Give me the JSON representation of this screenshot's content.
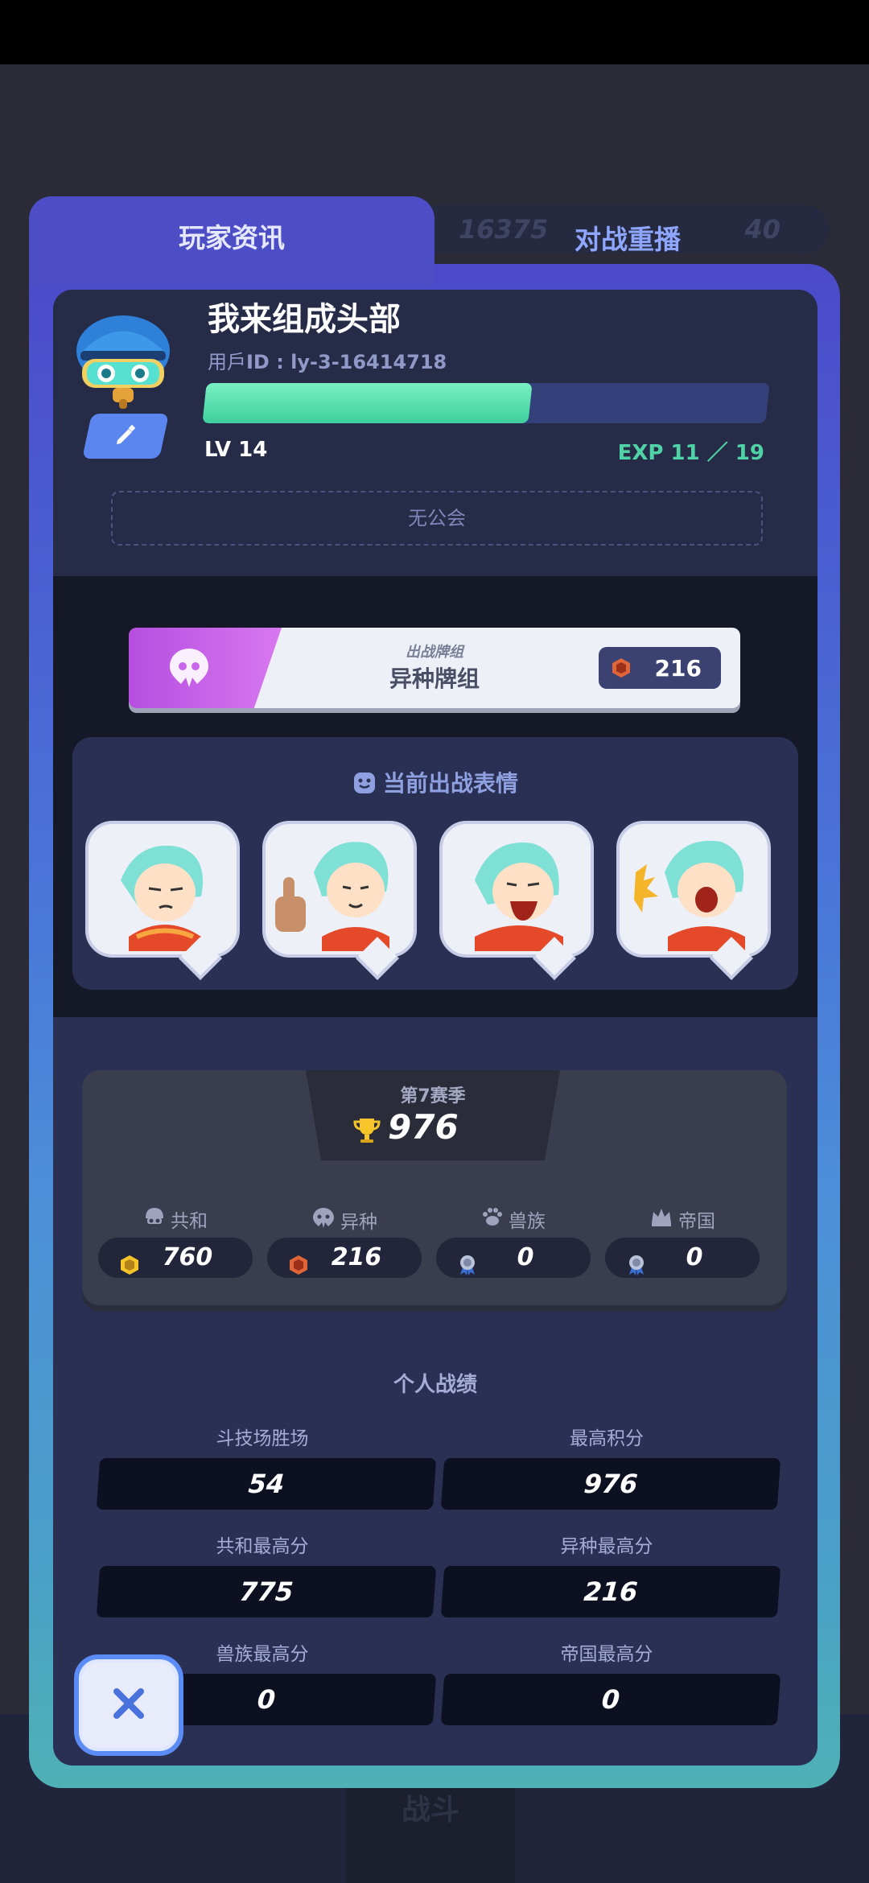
{
  "background": {
    "hud_gold": "16375",
    "hud_gems": "40",
    "bottom_label": "战斗"
  },
  "tabs": {
    "active": "玩家资讯",
    "inactive": "对战重播"
  },
  "profile": {
    "name": "我来组成头部",
    "uid_prefix": "用戶",
    "uid": "ID : ly-3-16414718",
    "level": "LV 14",
    "exp": "EXP 11 ／ 19",
    "exp_fraction": 0.579,
    "guild": "无公会",
    "avatar_icon": "robot-helmet-avatar-icon",
    "edit_icon": "pencil-icon"
  },
  "deck": {
    "sub_label": "出战牌组",
    "name": "异种牌组",
    "score": "216",
    "accent": "#c65ee8"
  },
  "emotes": {
    "title": "当前出战表情",
    "items": [
      "emote-sleepy",
      "emote-thumbs-up",
      "emote-laughing",
      "emote-shouting"
    ]
  },
  "season": {
    "label": "第7赛季",
    "score": "976",
    "factions": [
      {
        "name": "共和",
        "value": "760",
        "icon": "helmet-icon",
        "gem": "gold-gem-icon"
      },
      {
        "name": "异种",
        "value": "216",
        "icon": "alien-icon",
        "gem": "red-gem-icon"
      },
      {
        "name": "兽族",
        "value": "0",
        "icon": "paw-icon",
        "gem": "medal-icon"
      },
      {
        "name": "帝国",
        "value": "0",
        "icon": "crown-icon",
        "gem": "medal-icon"
      }
    ]
  },
  "stats": {
    "title": "个人战绩",
    "items": [
      {
        "label": "斗技场胜场",
        "value": "54"
      },
      {
        "label": "最高积分",
        "value": "976"
      },
      {
        "label": "共和最高分",
        "value": "775"
      },
      {
        "label": "异种最高分",
        "value": "216"
      },
      {
        "label": "兽族最高分",
        "value": "0"
      },
      {
        "label": "帝国最高分",
        "value": "0"
      }
    ]
  },
  "colors": {
    "frame_top": "#4b4ac9",
    "frame_bottom": "#4fb1b6",
    "exp_green": "#4fd3a6"
  }
}
